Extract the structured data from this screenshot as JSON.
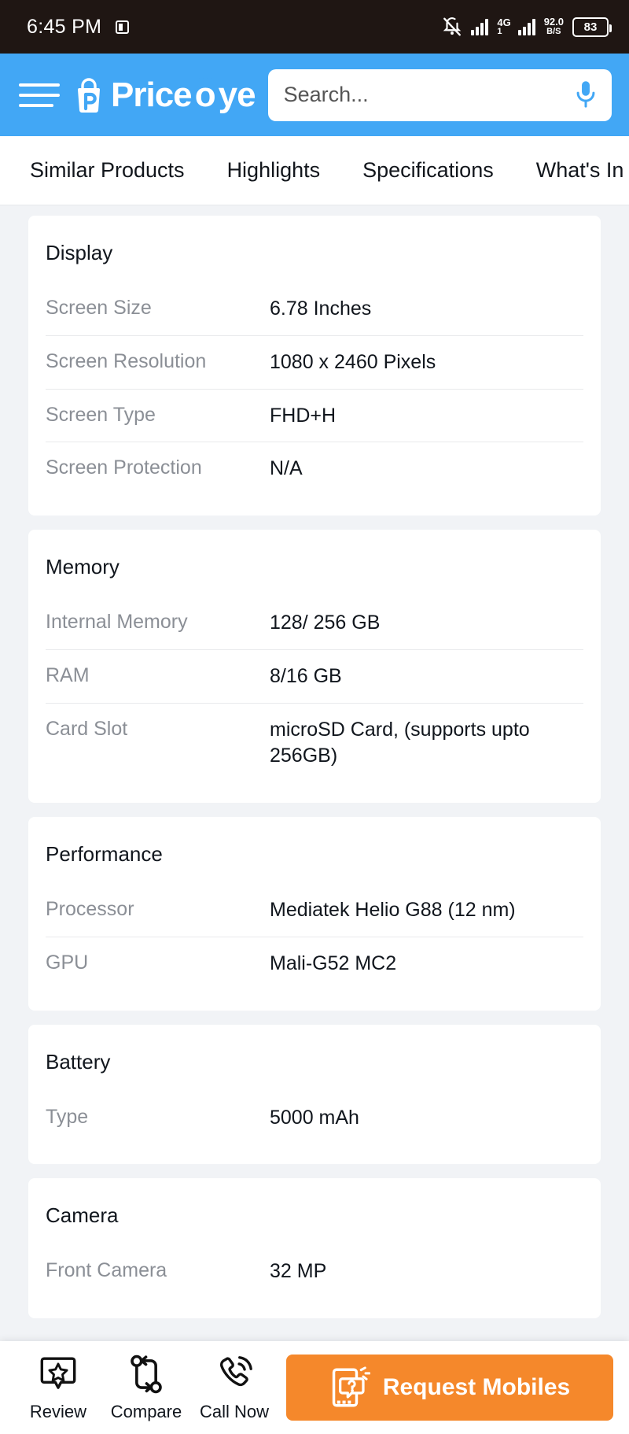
{
  "status_bar": {
    "time": "6:45 PM",
    "cast_icon": "screen-cast-icon",
    "mute_icon": "bell-muted-icon",
    "signal_icon": "signal-bars-icon",
    "network_type": "4G",
    "network_sub": "1",
    "data_speed_value": "92.0",
    "data_speed_unit": "B/S",
    "battery_level": "83"
  },
  "header": {
    "menu_icon": "hamburger-menu-icon",
    "logo_text_before": "Price",
    "logo_text_o": "o",
    "logo_text_after": "ye",
    "logo_mark": "shopping-bag-p-icon",
    "search_placeholder": "Search...",
    "search_value": "",
    "mic_icon": "microphone-icon",
    "brand_color": "#42a7f5"
  },
  "tabs": [
    {
      "label": "Similar Products"
    },
    {
      "label": "Highlights"
    },
    {
      "label": "Specifications"
    },
    {
      "label": "What's In Th"
    }
  ],
  "spec_cards": [
    {
      "title": "Display",
      "rows": [
        {
          "label": "Screen Size",
          "value": "6.78 Inches"
        },
        {
          "label": "Screen Resolution",
          "value": "1080 x 2460 Pixels"
        },
        {
          "label": "Screen Type",
          "value": "FHD+H"
        },
        {
          "label": "Screen Protection",
          "value": "N/A"
        }
      ]
    },
    {
      "title": "Memory",
      "rows": [
        {
          "label": "Internal Memory",
          "value": "128/ 256 GB"
        },
        {
          "label": "RAM",
          "value": "8/16 GB"
        },
        {
          "label": "Card Slot",
          "value": "microSD Card, (supports upto 256GB)"
        }
      ]
    },
    {
      "title": "Performance",
      "rows": [
        {
          "label": "Processor",
          "value": "Mediatek Helio G88 (12 nm)"
        },
        {
          "label": "GPU",
          "value": "Mali-G52 MC2"
        }
      ]
    },
    {
      "title": "Battery",
      "rows": [
        {
          "label": "Type",
          "value": "5000 mAh"
        }
      ]
    },
    {
      "title": "Camera",
      "rows": [
        {
          "label": "Front Camera",
          "value": "32 MP"
        }
      ]
    }
  ],
  "bottom_bar": {
    "items": [
      {
        "label": "Review",
        "icon": "review-star-bubble-icon"
      },
      {
        "label": "Compare",
        "icon": "compare-arrows-icon"
      },
      {
        "label": "Call Now",
        "icon": "phone-ring-icon"
      }
    ],
    "request_button": {
      "label": "Request Mobiles",
      "icon": "mobile-question-icon",
      "color": "#f5882b"
    }
  }
}
